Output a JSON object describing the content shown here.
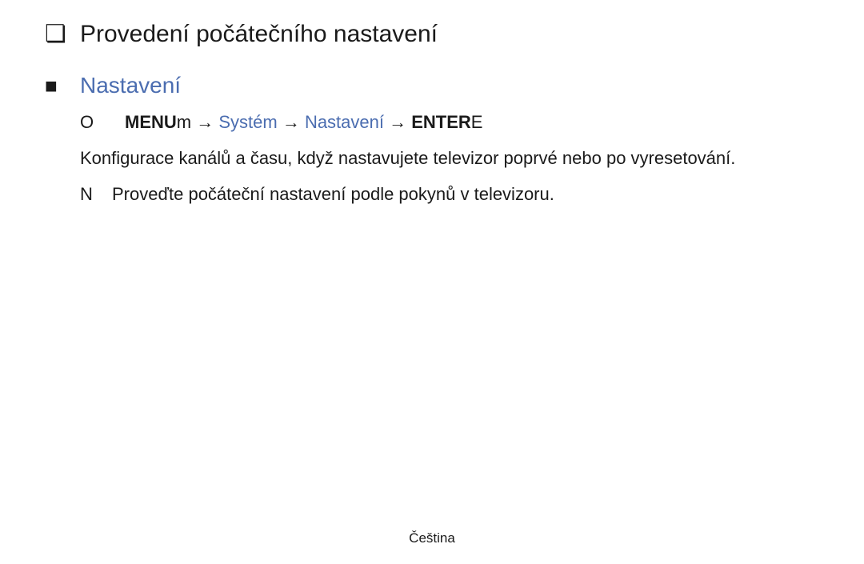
{
  "title": {
    "bullet": "❏",
    "text": "Provedení počátečního nastavení"
  },
  "section": {
    "bullet": "■",
    "text": "Nastavení"
  },
  "nav": {
    "bullet": "O",
    "menu_bold": "MENU",
    "menu_suffix": "m",
    "arrow1": "  → ",
    "system": "Systém",
    "arrow2": " → ",
    "settings": "Nastavení",
    "arrow3": " → ",
    "enter_bold": "ENTER",
    "enter_suffix": "E"
  },
  "body": "Konfigurace kanálů a času, když nastavujete televizor poprvé nebo po vyresetování.",
  "note": {
    "bullet": "N",
    "text": "Proveďte počáteční nastavení podle pokynů v televizoru."
  },
  "footer": "Čeština"
}
